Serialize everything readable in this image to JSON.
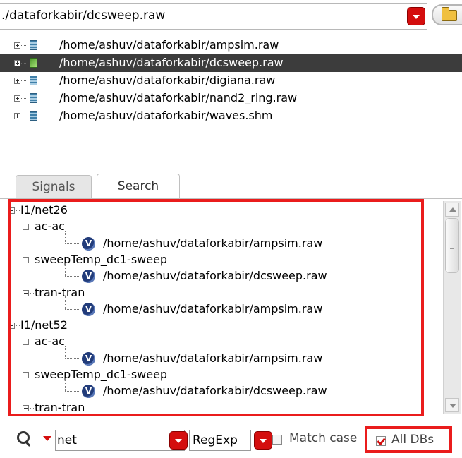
{
  "path_combo": {
    "value": "./dataforkabir/dcsweep.raw"
  },
  "databases": [
    {
      "label": "/home/ashuv/dataforkabir/ampsim.raw",
      "selected": false
    },
    {
      "label": "/home/ashuv/dataforkabir/dcsweep.raw",
      "selected": true
    },
    {
      "label": "/home/ashuv/dataforkabir/digiana.raw",
      "selected": false
    },
    {
      "label": "/home/ashuv/dataforkabir/nand2_ring.raw",
      "selected": false
    },
    {
      "label": "/home/ashuv/dataforkabir/waves.shm",
      "selected": false
    }
  ],
  "tabs": [
    {
      "label": "Signals",
      "active": false
    },
    {
      "label": "Search",
      "active": true
    }
  ],
  "results": {
    "items": [
      {
        "level": 0,
        "text": "I1/net26"
      },
      {
        "level": 1,
        "text": "ac-ac"
      },
      {
        "level": 2,
        "text": "/home/ashuv/dataforkabir/ampsim.raw",
        "icon": "v-icon"
      },
      {
        "level": 1,
        "text": "sweepTemp_dc1-sweep"
      },
      {
        "level": 2,
        "text": "/home/ashuv/dataforkabir/dcsweep.raw",
        "icon": "v-icon"
      },
      {
        "level": 1,
        "text": "tran-tran"
      },
      {
        "level": 2,
        "text": "/home/ashuv/dataforkabir/ampsim.raw",
        "icon": "v-icon"
      },
      {
        "level": 0,
        "text": "I1/net52"
      },
      {
        "level": 1,
        "text": "ac-ac"
      },
      {
        "level": 2,
        "text": "/home/ashuv/dataforkabir/ampsim.raw",
        "icon": "v-icon"
      },
      {
        "level": 1,
        "text": "sweepTemp_dc1-sweep"
      },
      {
        "level": 2,
        "text": "/home/ashuv/dataforkabir/dcsweep.raw",
        "icon": "v-icon"
      },
      {
        "level": 1,
        "text": "tran-tran"
      }
    ]
  },
  "toolbar": {
    "search_value": "net",
    "mode": "RegExp",
    "match_case_label": "Match case",
    "match_case_checked": false,
    "all_dbs_label": "All DBs",
    "all_dbs_checked": true
  },
  "colors": {
    "accent_red": "#d40e0e",
    "highlight_red": "#ea1c1c",
    "selection": "#3c3c3c"
  }
}
